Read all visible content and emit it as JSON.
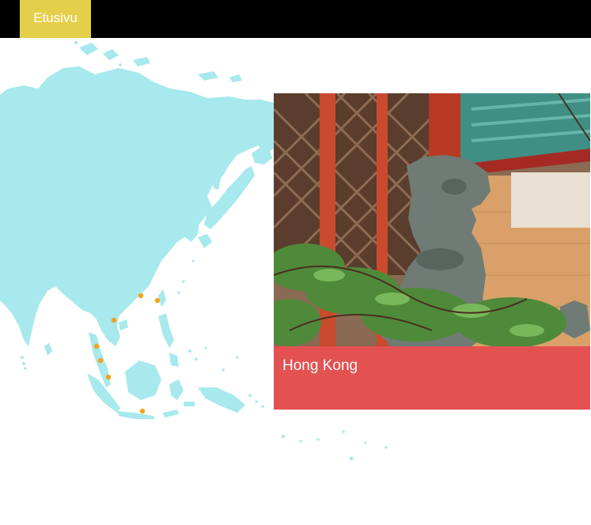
{
  "nav": {
    "home_label": "Etusivu",
    "accent_color": "#e4cf4a",
    "bar_color": "#000000"
  },
  "map": {
    "land_color": "#a7e9ec",
    "marker_color": "#f5a21a"
  },
  "card": {
    "title": "Hong Kong",
    "caption_color": "#e45151",
    "photo_subject": "stone-lion-statue-temple"
  }
}
